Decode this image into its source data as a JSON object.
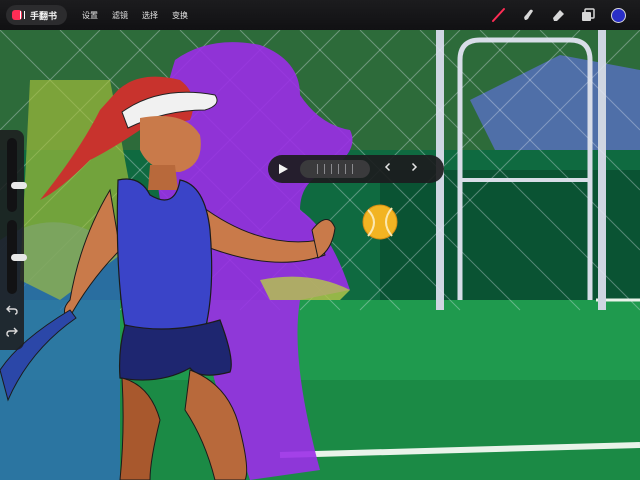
{
  "app": {
    "name": "手翻书",
    "logo_icon": "app-logo-icon"
  },
  "menu": [
    {
      "label": "设置"
    },
    {
      "label": "滤镜"
    },
    {
      "label": "选择"
    },
    {
      "label": "变换"
    }
  ],
  "tools": {
    "items": [
      "brush-icon",
      "smudge-icon",
      "eraser-icon",
      "layers-icon"
    ],
    "current_color": "#2a2fc7"
  },
  "sidebar": {
    "brush_size": 0.35,
    "brush_opacity": 0.5,
    "undo_icon": "undo-icon",
    "redo_icon": "redo-icon"
  },
  "player": {
    "play_icon": "play-icon",
    "prev_icon": "chevron-left-icon",
    "next_icon": "chevron-right-icon"
  },
  "colors": {
    "accent": "#ff2d55",
    "onion_skin": "#9b2ee8",
    "shirt": "#3a44c8",
    "hair": "#c8332d",
    "court": "#1f9a4e"
  }
}
